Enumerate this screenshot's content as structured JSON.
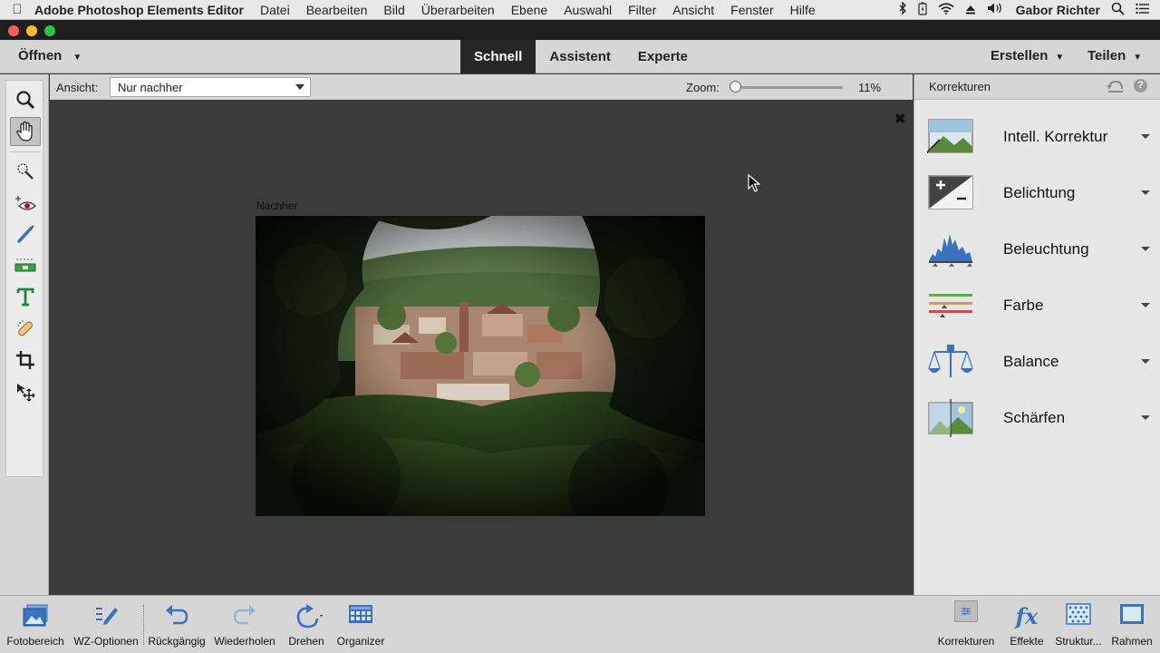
{
  "menubar": {
    "app_name": "Adobe Photoshop Elements Editor",
    "items": [
      "Datei",
      "Bearbeiten",
      "Bild",
      "Überarbeiten",
      "Ebene",
      "Auswahl",
      "Filter",
      "Ansicht",
      "Fenster",
      "Hilfe"
    ],
    "user": "Gabor Richter"
  },
  "modebar": {
    "open_label": "Öffnen",
    "tabs": [
      {
        "label": "Schnell",
        "active": true
      },
      {
        "label": "Assistent",
        "active": false
      },
      {
        "label": "Experte",
        "active": false
      }
    ],
    "create_label": "Erstellen",
    "share_label": "Teilen"
  },
  "toolbox": {
    "tools": [
      "zoom-tool",
      "hand-tool",
      "quick-selection-tool",
      "red-eye-tool",
      "whiten-teeth-tool",
      "straighten-tool",
      "type-tool",
      "spot-healing-tool",
      "crop-tool",
      "move-tool"
    ],
    "active_tool": "hand-tool"
  },
  "options": {
    "view_label": "Ansicht:",
    "view_value": "Nur nachher",
    "zoom_label": "Zoom:",
    "zoom_value": "11%"
  },
  "canvas": {
    "after_label": "Nachher"
  },
  "panel": {
    "title": "Korrekturen",
    "items": [
      {
        "label": "Intell. Korrektur",
        "icon": "smart-fix-icon"
      },
      {
        "label": "Belichtung",
        "icon": "exposure-icon"
      },
      {
        "label": "Beleuchtung",
        "icon": "lighting-icon"
      },
      {
        "label": "Farbe",
        "icon": "color-icon"
      },
      {
        "label": "Balance",
        "icon": "balance-icon"
      },
      {
        "label": "Schärfen",
        "icon": "sharpen-icon"
      }
    ]
  },
  "bottombar": {
    "photo_bin": "Fotobereich",
    "tool_options": "WZ-Optionen",
    "undo": "Rückgängig",
    "redo": "Wiederholen",
    "rotate": "Drehen",
    "organizer": "Organizer",
    "adjustments": "Korrekturen",
    "effects": "Effekte",
    "textures": "Struktur...",
    "frames": "Rahmen"
  },
  "colors": {
    "accent_blue": "#3a72c0",
    "canvas_bg": "#3b3b3b",
    "active_tab": "#262626"
  }
}
